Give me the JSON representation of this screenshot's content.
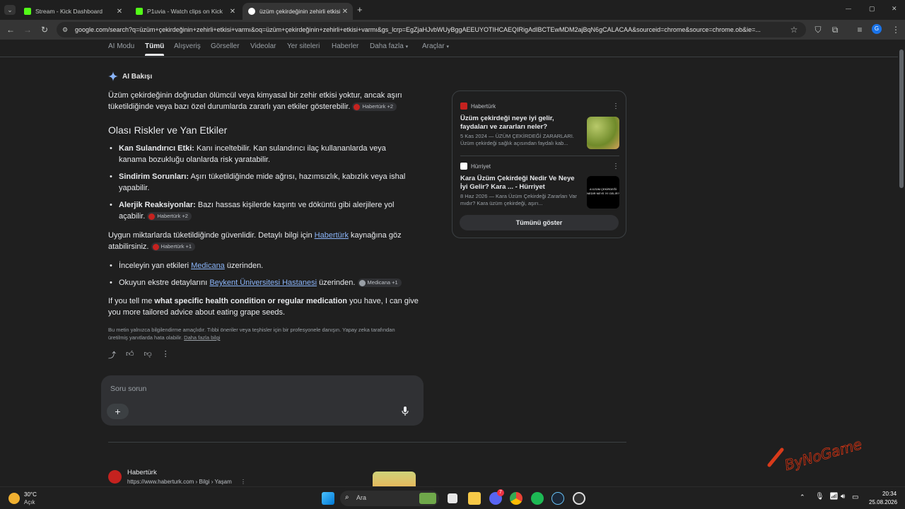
{
  "tabs": [
    {
      "title": "Stream - Kick Dashboard",
      "close": "✕"
    },
    {
      "title": "P1uvia - Watch clips on Kick",
      "close": "✕"
    },
    {
      "title": "üzüm çekirdeğinin zehirli etkisi",
      "close": "✕"
    }
  ],
  "new_tab": "+",
  "window_controls": {
    "minimize": "—",
    "restore": "▢",
    "close": "✕"
  },
  "url": "google.com/search?q=üzüm+çekirdeğinin+zehirli+etkisi+varmı&oq=üzüm+çekirdeğinin+zehirli+etkisi+varmı&gs_lcrp=EgZjaHJvbWUyBggAEEUYOTIHCAEQIRigAdIBCTEwMDM2ajBqN6gCALACAA&sourceid=chrome&source=chrome.ob&ie=...",
  "profile_initial": "G",
  "nav_tabs": [
    "AI Modu",
    "Tümü",
    "Alışveriş",
    "Görseller",
    "Videolar",
    "Yer siteleri",
    "Haberler",
    "Daha fazla",
    "Araçlar"
  ],
  "ai": {
    "header": "AI Bakışı",
    "intro": "Üzüm çekirdeğinin doğrudan ölümcül veya kimyasal bir zehir etkisi yoktur, ancak aşırı tüketildiğinde veya bazı özel durumlarda zararlı yan etkiler gösterebilir.",
    "intro_chip": "Habertürk +2",
    "risks_heading": "Olası Riskler ve Yan Etkiler",
    "risks": [
      {
        "bold": "Kan Sulandırıcı Etki:",
        "text": " Kanı inceltebilir. Kan sulandırıcı ilaç kullananlarda veya kanama bozukluğu olanlarda risk yaratabilir.",
        "chip": ""
      },
      {
        "bold": "Sindirim Sorunları:",
        "text": " Aşırı tüketildiğinde mide ağrısı, hazımsızlık, kabızlık veya ishal yapabilir.",
        "chip": ""
      },
      {
        "bold": "Alerjik Reaksiyonlar:",
        "text": " Bazı hassas kişilerde kaşıntı ve döküntü gibi alerjilere yol açabilir.",
        "chip": "Habertürk +2"
      }
    ],
    "safe_text_1": "Uygun miktarlarda tüketildiğinde güvenlidir. Detaylı bilgi için ",
    "safe_link": "Habertürk",
    "safe_text_2": " kaynağına göz atabilirsiniz.",
    "safe_chip": "Habertürk +1",
    "links": [
      {
        "pre": "İnceleyin yan etkileri ",
        "link": "Medicana",
        "post": " üzerinden.",
        "chip": ""
      },
      {
        "pre": "Okuyun ekstre detaylarını ",
        "link": "Beykent Üniversitesi Hastanesi",
        "post": " üzerinden.",
        "chip": "Medicana +1"
      }
    ],
    "followup_1": "If you tell me ",
    "followup_bold": "what specific health condition or regular medication",
    "followup_2": " you have, I can give you more tailored advice about eating grape seeds.",
    "disclaimer": "Bu metin yalnızca bilgilendirme amaçlıdır. Tıbbi öneriler veya teşhisler için bir profesyonele danışın. Yapay zeka tarafından üretilmiş yanıtlarda hata olabilir.",
    "disclaimer_link": "Daha fazla bilgi",
    "ask_placeholder": "Soru sorun"
  },
  "cards": [
    {
      "source": "Habertürk",
      "title": "Üzüm çekirdeği neye iyi gelir, faydaları ve zararları neler?",
      "snippet": "5 Kas 2024 — ÜZÜM ÇEKİRDEĞİ ZARARLARI. Üzüm çekirdeği sağlık açısından faydalı kab...",
      "img_text": ""
    },
    {
      "source": "Hürriyet",
      "title": "Kara Üzüm Çekirdeği Nedir Ve Neye İyi Gelir? Kara ... - Hürriyet",
      "snippet": "8 Haz 2026 — Kara Üzüm Çekirdeği Zararları Var mıdır? Kara üzüm çekirdeği, aşırı...",
      "img_text": "A ÜZÜM ÇEKİRDEĞİ NEDİR NEYE İYİ GELİR?"
    }
  ],
  "show_all": "Tümünü göster",
  "result": {
    "site": "Habertürk",
    "url": "https://www.haberturk.com › Bilgi › Yaşam"
  },
  "watermark": "ByNoGame",
  "taskbar": {
    "weather_temp": "30°C",
    "weather_desc": "Açık",
    "search_placeholder": "Ara",
    "badge": "7",
    "time": "20:34",
    "date": "25.08.2026"
  },
  "colors": {
    "accent_link": "#8ab4f8",
    "kick_green": "#53fc18",
    "chip_red": "#c5221f"
  }
}
